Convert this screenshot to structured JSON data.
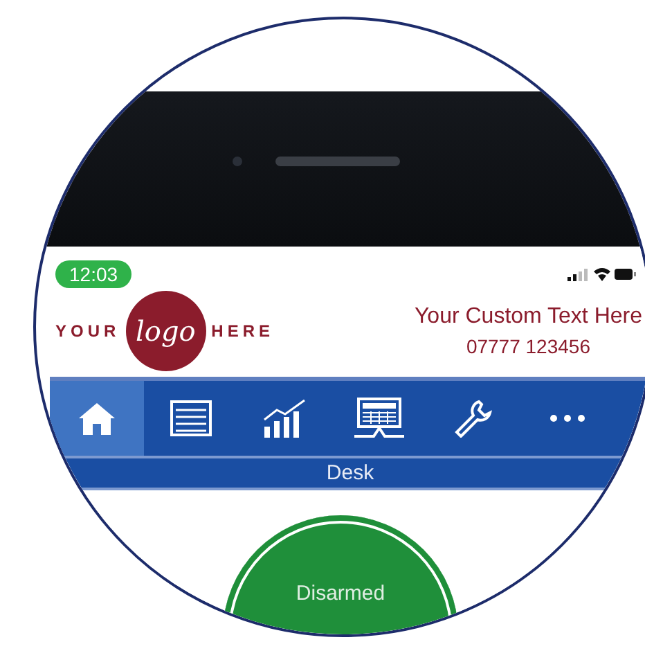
{
  "status_bar": {
    "time": "12:03"
  },
  "header": {
    "logo": {
      "left_word": "YOUR",
      "center_word": "logo",
      "right_word": "HERE"
    },
    "custom_text": "Your Custom Text Here",
    "phone": "07777 123456"
  },
  "nav_tabs": [
    {
      "kind": "home",
      "selected": true
    },
    {
      "kind": "list",
      "selected": false
    },
    {
      "kind": "chart",
      "selected": false
    },
    {
      "kind": "keypad",
      "selected": false
    },
    {
      "kind": "wrench",
      "selected": false
    },
    {
      "kind": "more",
      "selected": false
    }
  ],
  "page_title": "Desk",
  "system_status": {
    "label": "Disarmed"
  }
}
